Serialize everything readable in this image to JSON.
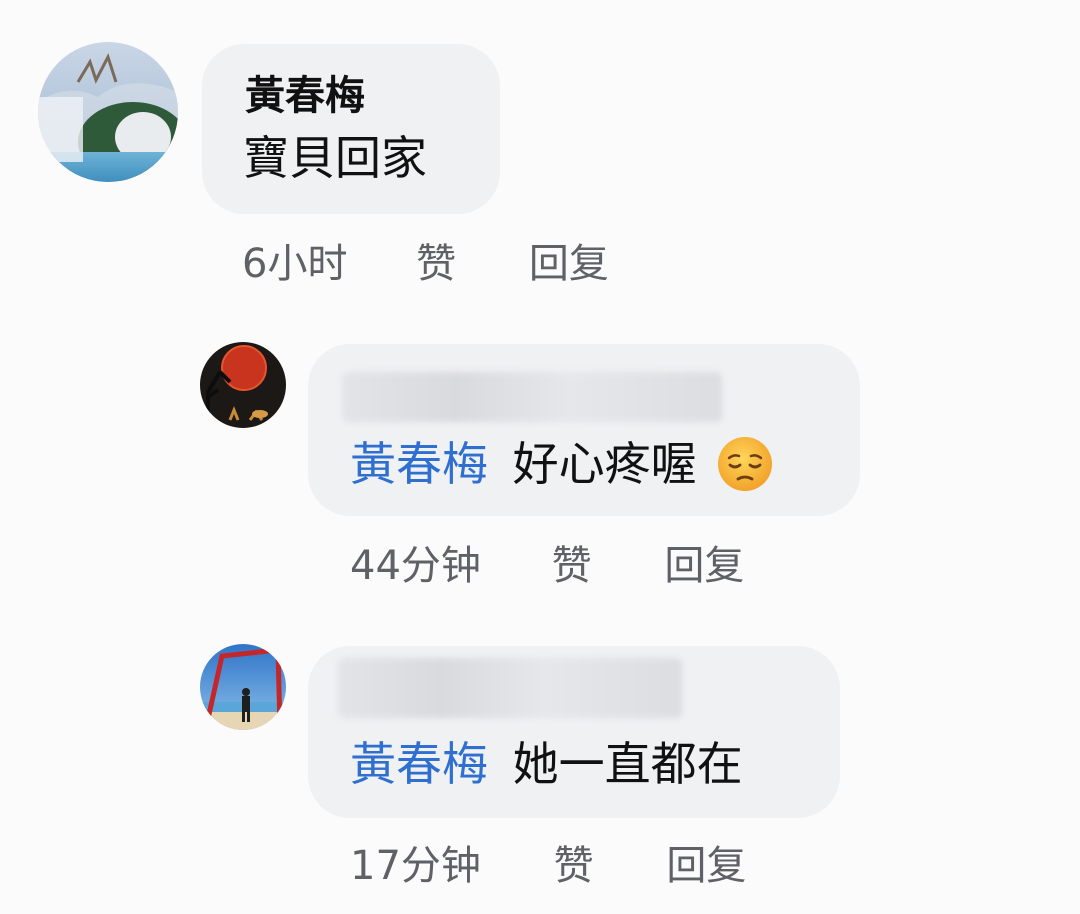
{
  "comments": [
    {
      "author": "黃春梅",
      "text": "寶貝回家",
      "time": "6小时",
      "like_label": "赞",
      "reply_label": "回复"
    },
    {
      "mention": "黃春梅",
      "text": "好心疼喔",
      "emoji": "pensive-face-icon",
      "time": "44分钟",
      "like_label": "赞",
      "reply_label": "回复"
    },
    {
      "mention": "黃春梅",
      "text": "她一直都在",
      "time": "17分钟",
      "like_label": "赞",
      "reply_label": "回复"
    }
  ],
  "colors": {
    "mention": "#2f6fd0",
    "bubble": "#f0f1f3",
    "meta": "#5f6166"
  }
}
